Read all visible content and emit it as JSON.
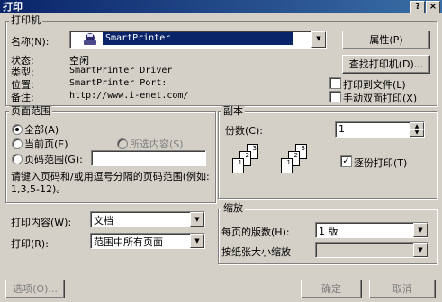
{
  "window": {
    "title": "打印",
    "help_btn": "?",
    "close_btn": "×"
  },
  "printer": {
    "group_label": "打印机",
    "name_label": "名称(N):",
    "name_value": "SmartPrinter",
    "properties_btn": "属性(P)",
    "find_btn": "查找打印机(D)...",
    "status_label": "状态:",
    "status_value": "空闲",
    "type_label": "类型:",
    "type_value": "SmartPrinter Driver",
    "location_label": "位置:",
    "location_value": "SmartPrinter Port:",
    "comment_label": "备注:",
    "comment_value": "http://www.i-enet.com/",
    "print_to_file": {
      "label": "打印到文件(L)",
      "checked": false
    },
    "manual_duplex": {
      "label": "手动双面打印(X)",
      "checked": false
    }
  },
  "page_range": {
    "group_label": "页面范围",
    "all": "全部(A)",
    "current": "当前页(E)",
    "selection": "所选内容(S)",
    "pages": "页码范围(G):",
    "pages_value": "",
    "hint": "请键入页码和/或用逗号分隔的页码范围(例如: 1,3,5-12)。"
  },
  "copies": {
    "group_label": "副本",
    "count_label": "份数(C):",
    "count_value": "1",
    "collate_label": "逐份打印(T)",
    "collate_checked": true,
    "page_numbers": [
      "1",
      "2",
      "3",
      "1",
      "2",
      "3"
    ]
  },
  "print_what": {
    "label": "打印内容(W):",
    "value": "文档"
  },
  "print_opt": {
    "label": "打印(R):",
    "value": "范围中所有页面"
  },
  "zoom": {
    "group_label": "缩放",
    "pages_per_sheet_label": "每页的版数(H):",
    "pages_per_sheet_value": "1 版",
    "scale_label": "按纸张大小缩放"
  },
  "footer": {
    "options_btn": "选项(O)...",
    "ok_btn": "确定",
    "cancel_btn": "取消"
  }
}
